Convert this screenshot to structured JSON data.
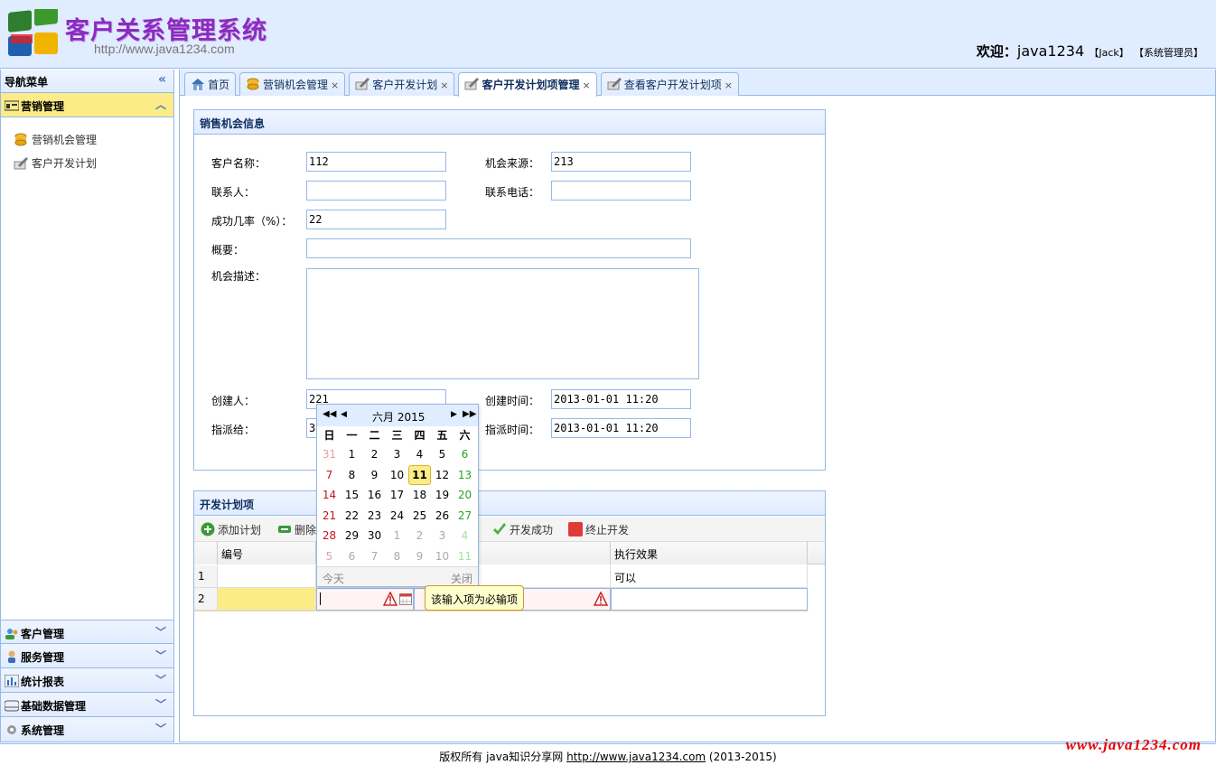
{
  "header": {
    "title": "客户关系管理系统",
    "url": "http://www.java1234.com",
    "welcome_label": "欢迎：",
    "user": "java1234",
    "user_name": "【Jack】",
    "role": "【系统管理员】"
  },
  "nav": {
    "title": "导航菜单",
    "sections": [
      {
        "label": "营销管理",
        "icon": "marketing-icon",
        "items": [
          {
            "label": "营销机会管理",
            "icon": "coins-icon"
          },
          {
            "label": "客户开发计划",
            "icon": "pencil-icon"
          }
        ]
      },
      {
        "label": "客户管理",
        "icon": "customer-icon"
      },
      {
        "label": "服务管理",
        "icon": "service-icon"
      },
      {
        "label": "统计报表",
        "icon": "report-icon"
      },
      {
        "label": "基础数据管理",
        "icon": "database-icon"
      },
      {
        "label": "系统管理",
        "icon": "gear-icon"
      }
    ]
  },
  "tabs": [
    {
      "label": "首页",
      "icon": "home-icon",
      "closable": false
    },
    {
      "label": "营销机会管理",
      "icon": "coins-icon",
      "closable": true
    },
    {
      "label": "客户开发计划",
      "icon": "pencil-icon",
      "closable": true
    },
    {
      "label": "客户开发计划项管理",
      "icon": "pencil-icon",
      "closable": true,
      "active": true
    },
    {
      "label": "查看客户开发计划项",
      "icon": "pencil-icon",
      "closable": true
    }
  ],
  "close_symbol": "×",
  "sales_panel": {
    "title": "销售机会信息",
    "fields": {
      "customer_name": {
        "label": "客户名称：",
        "value": "112"
      },
      "source": {
        "label": "机会来源：",
        "value": "213"
      },
      "contact": {
        "label": "联系人：",
        "value": ""
      },
      "phone": {
        "label": "联系电话：",
        "value": ""
      },
      "success_rate": {
        "label": "成功几率（%）：",
        "value": "22"
      },
      "summary": {
        "label": "概要：",
        "value": ""
      },
      "description": {
        "label": "机会描述：",
        "value": ""
      },
      "creator": {
        "label": "创建人：",
        "value": "221"
      },
      "create_time": {
        "label": "创建时间：",
        "value": "2013-01-01 11:20"
      },
      "assignee": {
        "label": "指派给：",
        "value": "3"
      },
      "assign_time": {
        "label": "指派时间：",
        "value": "2013-01-01 11:20"
      }
    }
  },
  "plan_panel": {
    "title": "开发计划项",
    "toolbar": {
      "add": "添加计划",
      "delete": "删除",
      "success": "开发成功",
      "stop": "终止开发"
    },
    "columns": [
      "编号",
      "执行效果"
    ],
    "rows": [
      {
        "num": "1",
        "effect": "可以"
      },
      {
        "num": "2",
        "effect": ""
      }
    ]
  },
  "calendar": {
    "month_year": "六月 2015",
    "weekdays": [
      "日",
      "一",
      "二",
      "三",
      "四",
      "五",
      "六"
    ],
    "weeks": [
      [
        "31",
        "1",
        "2",
        "3",
        "4",
        "5",
        "6"
      ],
      [
        "7",
        "8",
        "9",
        "10",
        "11",
        "12",
        "13"
      ],
      [
        "14",
        "15",
        "16",
        "17",
        "18",
        "19",
        "20"
      ],
      [
        "21",
        "22",
        "23",
        "24",
        "25",
        "26",
        "27"
      ],
      [
        "28",
        "29",
        "30",
        "1",
        "2",
        "3",
        "4"
      ],
      [
        "5",
        "6",
        "7",
        "8",
        "9",
        "10",
        "11"
      ]
    ],
    "selected": "11",
    "today_label": "今天",
    "close_label": "关闭"
  },
  "tooltip": "该输入项为必输项",
  "footer": {
    "text": "版权所有 java知识分享网 ",
    "link": "http://www.java1234.com",
    "years": " (2013-2015)"
  },
  "watermark": "www.java1234.com",
  "colors": {
    "accent": "#95B8E7",
    "header_bg": "#E0ECFF",
    "active": "#FBEC88",
    "title": "#8A2BBF"
  }
}
